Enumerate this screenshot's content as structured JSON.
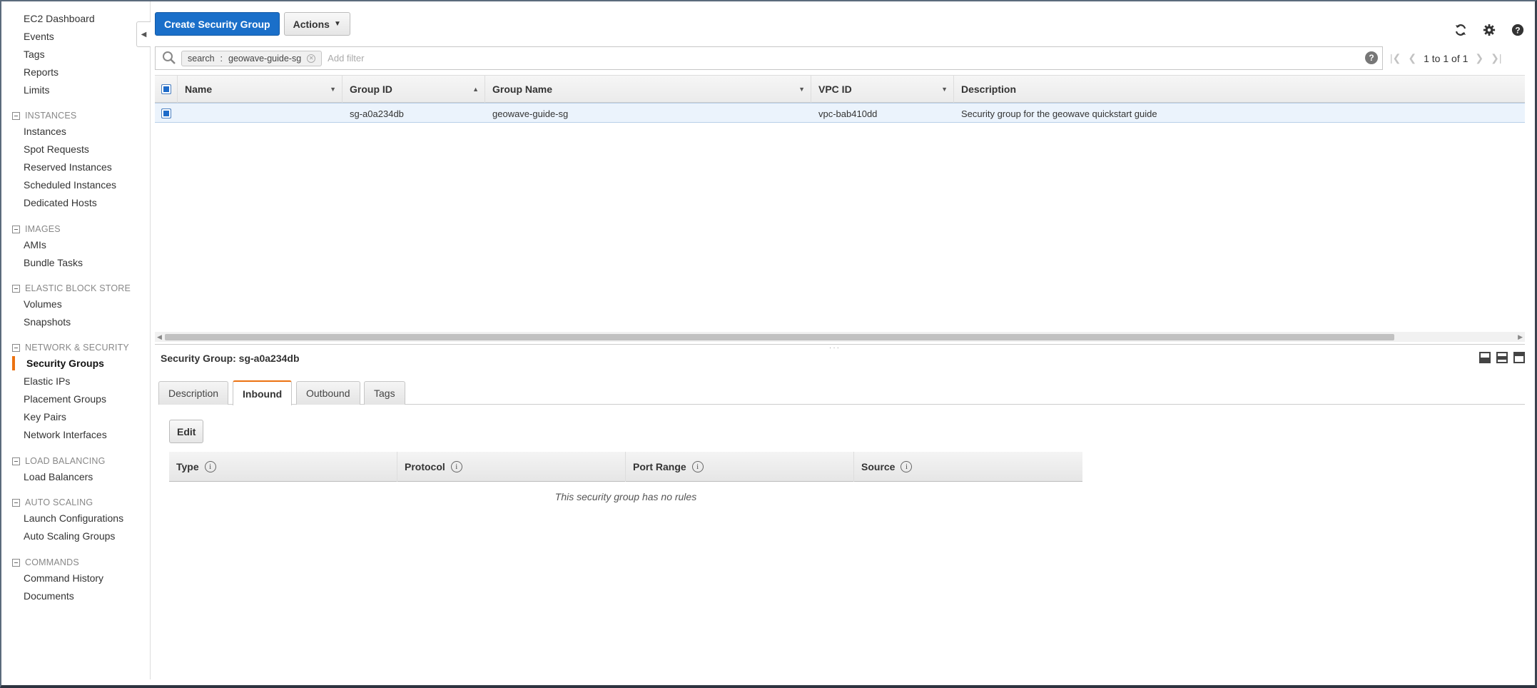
{
  "sidebar": {
    "top_items": [
      "EC2 Dashboard",
      "Events",
      "Tags",
      "Reports",
      "Limits"
    ],
    "sections": [
      {
        "title": "INSTANCES",
        "items": [
          "Instances",
          "Spot Requests",
          "Reserved Instances",
          "Scheduled Instances",
          "Dedicated Hosts"
        ]
      },
      {
        "title": "IMAGES",
        "items": [
          "AMIs",
          "Bundle Tasks"
        ]
      },
      {
        "title": "ELASTIC BLOCK STORE",
        "items": [
          "Volumes",
          "Snapshots"
        ]
      },
      {
        "title": "NETWORK & SECURITY",
        "items": [
          "Security Groups",
          "Elastic IPs",
          "Placement Groups",
          "Key Pairs",
          "Network Interfaces"
        ]
      },
      {
        "title": "LOAD BALANCING",
        "items": [
          "Load Balancers"
        ]
      },
      {
        "title": "AUTO SCALING",
        "items": [
          "Launch Configurations",
          "Auto Scaling Groups"
        ]
      },
      {
        "title": "COMMANDS",
        "items": [
          "Command History",
          "Documents"
        ]
      }
    ],
    "active_item": "Security Groups"
  },
  "toolbar": {
    "create_label": "Create Security Group",
    "actions_label": "Actions"
  },
  "icons": {
    "refresh": "refresh-icon",
    "settings": "gear-icon",
    "help": "help-icon"
  },
  "search": {
    "chip_key": "search",
    "chip_sep": ":",
    "chip_value": "geowave-guide-sg",
    "placeholder": "Add filter",
    "help": "?"
  },
  "pager": {
    "text": "1 to 1 of 1"
  },
  "grid": {
    "columns": [
      "Name",
      "Group ID",
      "Group Name",
      "VPC ID",
      "Description"
    ],
    "rows": [
      {
        "name": "",
        "group_id": "sg-a0a234db",
        "group_name": "geowave-guide-sg",
        "vpc_id": "vpc-bab410dd",
        "description": "Security group for the geowave quickstart guide"
      }
    ]
  },
  "details": {
    "title": "Security Group: sg-a0a234db",
    "tabs": [
      "Description",
      "Inbound",
      "Outbound",
      "Tags"
    ],
    "active_tab": "Inbound",
    "edit_label": "Edit",
    "rule_columns": [
      "Type",
      "Protocol",
      "Port Range",
      "Source"
    ],
    "empty_message": "This security group has no rules"
  },
  "colors": {
    "primary": "#1a6fc9",
    "accent": "#ec7211",
    "row_selected": "#ebf3fc"
  }
}
